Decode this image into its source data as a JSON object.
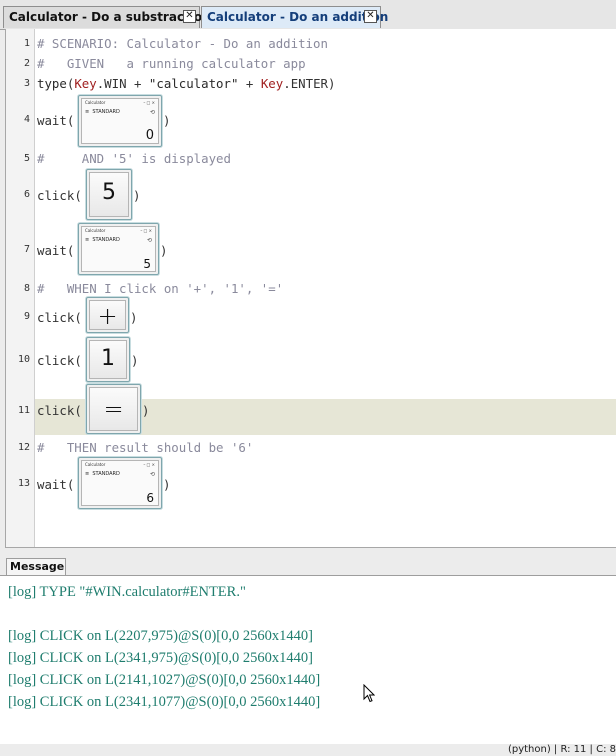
{
  "tabs": [
    {
      "label": "Calculator - Do a substraction",
      "active": false
    },
    {
      "label": "Calculator - Do an addition",
      "active": true
    }
  ],
  "editor": {
    "lines": [
      {
        "n": "1",
        "text": "# SCENARIO: Calculator - Do an addition"
      },
      {
        "n": "2",
        "text": "#   GIVEN   a running calculator app"
      },
      {
        "n": "3",
        "func": "type",
        "cls1": "Key",
        "attr1": ".WIN + ",
        "str": "\"calculator\"",
        "mid": " + ",
        "cls2": "Key",
        "attr2": ".ENTER"
      },
      {
        "n": "4",
        "func": "wait",
        "pattern": "calculator-screenshot",
        "display": "0",
        "menu": "STANDARD"
      },
      {
        "n": "5",
        "text": "#     AND '5' is displayed"
      },
      {
        "n": "6",
        "func": "click",
        "pattern": "key",
        "key": "5"
      },
      {
        "n": "7",
        "func": "wait",
        "pattern": "calculator-screenshot",
        "display": "5",
        "menu": "STANDARD"
      },
      {
        "n": "8",
        "text": "#   WHEN I click on '+', '1', '='"
      },
      {
        "n": "9",
        "func": "click",
        "pattern": "key",
        "key": "+"
      },
      {
        "n": "10",
        "func": "click",
        "pattern": "key",
        "key": "1"
      },
      {
        "n": "11",
        "func": "click",
        "pattern": "key",
        "key": "="
      },
      {
        "n": "12",
        "text": "#   THEN result should be '6'"
      },
      {
        "n": "13",
        "func": "wait",
        "pattern": "calculator-screenshot",
        "display": "6",
        "menu": "STANDARD"
      }
    ],
    "open_paren": "(",
    "close_paren": ")",
    "mini_title": "Calculator",
    "mini_hist": "⟲"
  },
  "message": {
    "tab_label": "Message",
    "logs": [
      "[log] TYPE \"#WIN.calculator#ENTER.\"",
      "",
      "[log] CLICK on L(2207,975)@S(0)[0,0 2560x1440]",
      "[log] CLICK on L(2341,975)@S(0)[0,0 2560x1440]",
      "[log] CLICK on L(2141,1027)@S(0)[0,0 2560x1440]",
      "[log] CLICK on L(2341,1077)@S(0)[0,0 2560x1440]"
    ]
  },
  "status": {
    "text": "(python) | R: 11 | C: 8"
  },
  "colors": {
    "comment": "#8a8a9c",
    "key_class": "#a02020",
    "log_text": "#1f7d6e",
    "current_line": "#e6e6d6",
    "active_tab": "#ddeaf7"
  }
}
